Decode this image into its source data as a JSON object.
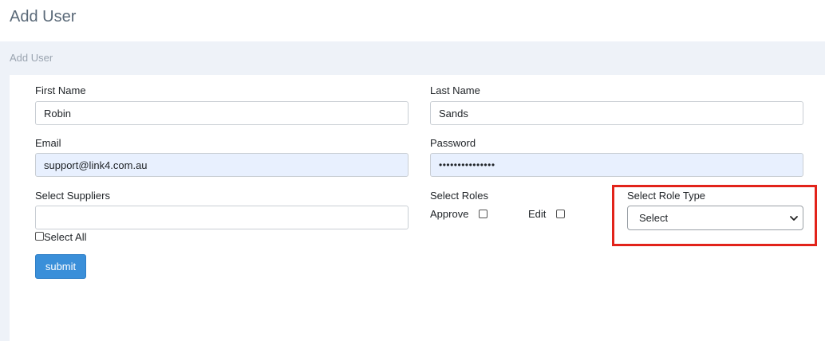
{
  "header": {
    "title": "Add User"
  },
  "breadcrumb": {
    "current": "Add User"
  },
  "form": {
    "first_name": {
      "label": "First Name",
      "value": "Robin"
    },
    "last_name": {
      "label": "Last Name",
      "value": "Sands"
    },
    "email": {
      "label": "Email",
      "value": "support@link4.com.au"
    },
    "password": {
      "label": "Password",
      "value": "•••••••••••••••"
    },
    "suppliers": {
      "label": "Select Suppliers",
      "value": "",
      "select_all_label": "Select All"
    },
    "roles": {
      "label": "Select Roles",
      "approve_label": "Approve",
      "edit_label": "Edit"
    },
    "role_type": {
      "label": "Select Role Type",
      "selected": "Select"
    },
    "submit_label": "submit"
  },
  "colors": {
    "highlight": "#e2231a",
    "submit": "#3a8fd9",
    "autofill": "#e8f0fe",
    "breadcrumb_bg": "#eef2f8"
  }
}
